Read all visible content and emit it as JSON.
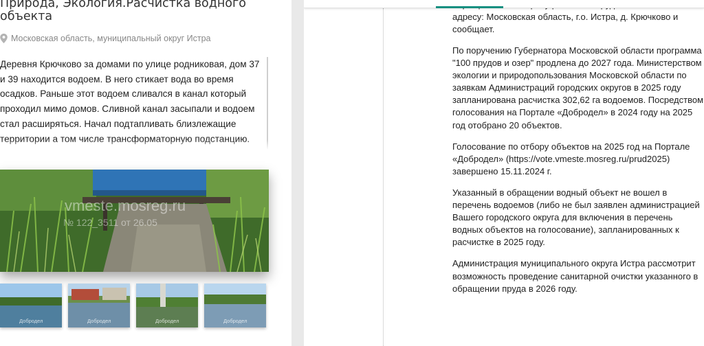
{
  "problem": {
    "title": "Природа, Экология.Расчистка водного объекта",
    "location": "Московская область, муниципальный округ Истра",
    "description": "Деревня Крючково за домами по улице родниковая, дом 37 и 39 находится водоем. В него стикает вода во время осадков. Раньше этот водоем сливался в канал который проходил мимо домов. Сливной канал засыпали и водоем стал расширяться. Начал подтапливать близлежащие территории а том числе трансформаторную подстанцию. Прошу разобраться пока не произошло какой-нибудь",
    "photo_watermark": "vmeste.mosreg.ru",
    "photo_number": "№ 122_3511 от 26.05",
    "thumbnail_watermark": "Добродел"
  },
  "answer": {
    "first_line_partial": "обращению по вопросу расчистки пруда по",
    "paragraphs": [
      "адресу: Московская область, г.о. Истра, д. Крючково и сообщает.",
      "По поручению Губернатора Московской области программа \"100 прудов и озер\" продлена до 2027 года. Министерством экологии и природопользования Московской области по заявкам Администраций городских округов в 2025 году запланирована расчистка 302,62 га водоемов. Посредством голосования на Портале «Добродел» в 2024 году на 2025 год отобрано 20 объектов.",
      "Голосование по отбору объектов на 2025 год на Портале «Добродел» (https://vote.vmeste.mosreg.ru/prud2025) завершено 15.11.2024 г.",
      "Указанный в обращении водный объект не вошел в перечень водоемов (либо не был заявлен администрацией Вашего городского округа для включения в перечень водных объектов на голосование), запланированных к расчистке в 2025 году.",
      "Администрация муниципального округа Истра рассмотрит возможность проведение санитарной очистки указанного в обращении пруда в 2026 году."
    ]
  },
  "colors": {
    "accent": "#148f80",
    "muted_text": "#888888"
  },
  "icons": {
    "location": "map-pin-icon"
  }
}
